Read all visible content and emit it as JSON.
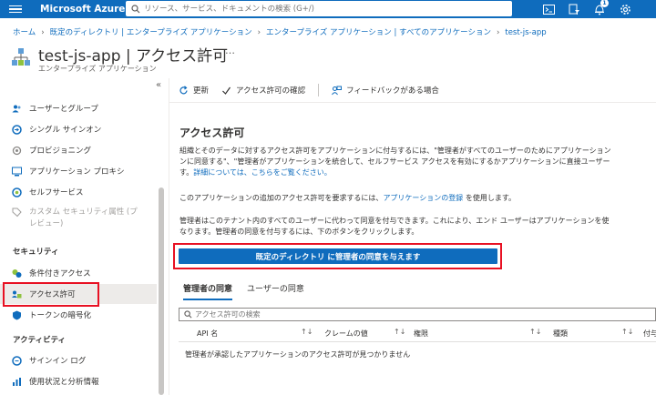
{
  "topbar": {
    "brand": "Microsoft Azure",
    "search_placeholder": "リソース、サービス、ドキュメントの検索 (G+/)",
    "notification_count": "1",
    "accent": "#0f6cbd"
  },
  "breadcrumb": [
    "ホーム",
    "既定のディレクトリ | エンタープライズ アプリケーション",
    "エンタープライズ アプリケーション | すべてのアプリケーション",
    "test-js-app"
  ],
  "page": {
    "title": "test-js-app | アクセス許可",
    "subtitle": "エンタープライズ アプリケーション",
    "more": "…"
  },
  "sidebar": {
    "collapse": "«",
    "items": [
      {
        "label": "ユーザーとグループ",
        "icon": "users-icon"
      },
      {
        "label": "シングル サインオン",
        "icon": "sso-icon"
      },
      {
        "label": "プロビジョニング",
        "icon": "provisioning-icon"
      },
      {
        "label": "アプリケーション プロキシ",
        "icon": "proxy-icon"
      },
      {
        "label": "セルフサービス",
        "icon": "self-service-icon"
      },
      {
        "label": "カスタム セキュリティ属性 (プ",
        "label2": "レビュー)",
        "icon": "custom-attr-icon"
      },
      {
        "label": "条件付きアクセス",
        "icon": "conditional-access-icon"
      },
      {
        "label": "アクセス許可",
        "icon": "permissions-icon"
      },
      {
        "label": "トークンの暗号化",
        "icon": "token-encryption-icon"
      },
      {
        "label": "サインイン ログ",
        "icon": "signin-logs-icon"
      },
      {
        "label": "使用状況と分析情報",
        "icon": "usage-insights-icon"
      }
    ],
    "sections": [
      "セキュリティ",
      "アクティビティ"
    ]
  },
  "commands": {
    "refresh": "更新",
    "review": "アクセス許可の確認",
    "feedback": "フィードバックがある場合"
  },
  "main": {
    "heading": "アクセス許可",
    "p1_line1": "組織とそのデータに対するアクセス許可をアプリケーションに付与するには、\"管理者がすべてのユーザーのためにアプリケーション",
    "p1_line2": "ンに同意する\"、\"管理者がアプリケーションを統合して、セルフサービス アクセスを有効にするかアプリケーションに直接ユーザー",
    "p1_line3_prefix": "す。",
    "p1_link": "詳細については、こちらをご覧ください。",
    "p2_prefix": "このアプリケーションの追加のアクセス許可を要求するには、",
    "p2_link": "アプリケーションの登録",
    "p2_suffix": " を使用します。",
    "p3_line1": "管理者はこのテナント内のすべてのユーザーに代わって同意を付与できます。これにより、エンド ユーザーはアプリケーションを使",
    "p3_line2": "なります。管理者の同意を付与するには、下のボタンをクリックします。",
    "consent_button": "既定のディレクトリ に管理者の同意を与えます",
    "tabs": [
      "管理者の同意",
      "ユーザーの同意"
    ],
    "filter_placeholder": "アクセス許可の検索",
    "columns": [
      "API 名",
      "クレームの値",
      "権限",
      "種類",
      "付与"
    ],
    "sort_glyph": "↑↓",
    "empty": "管理者が承認したアプリケーションのアクセス許可が見つかりません"
  }
}
